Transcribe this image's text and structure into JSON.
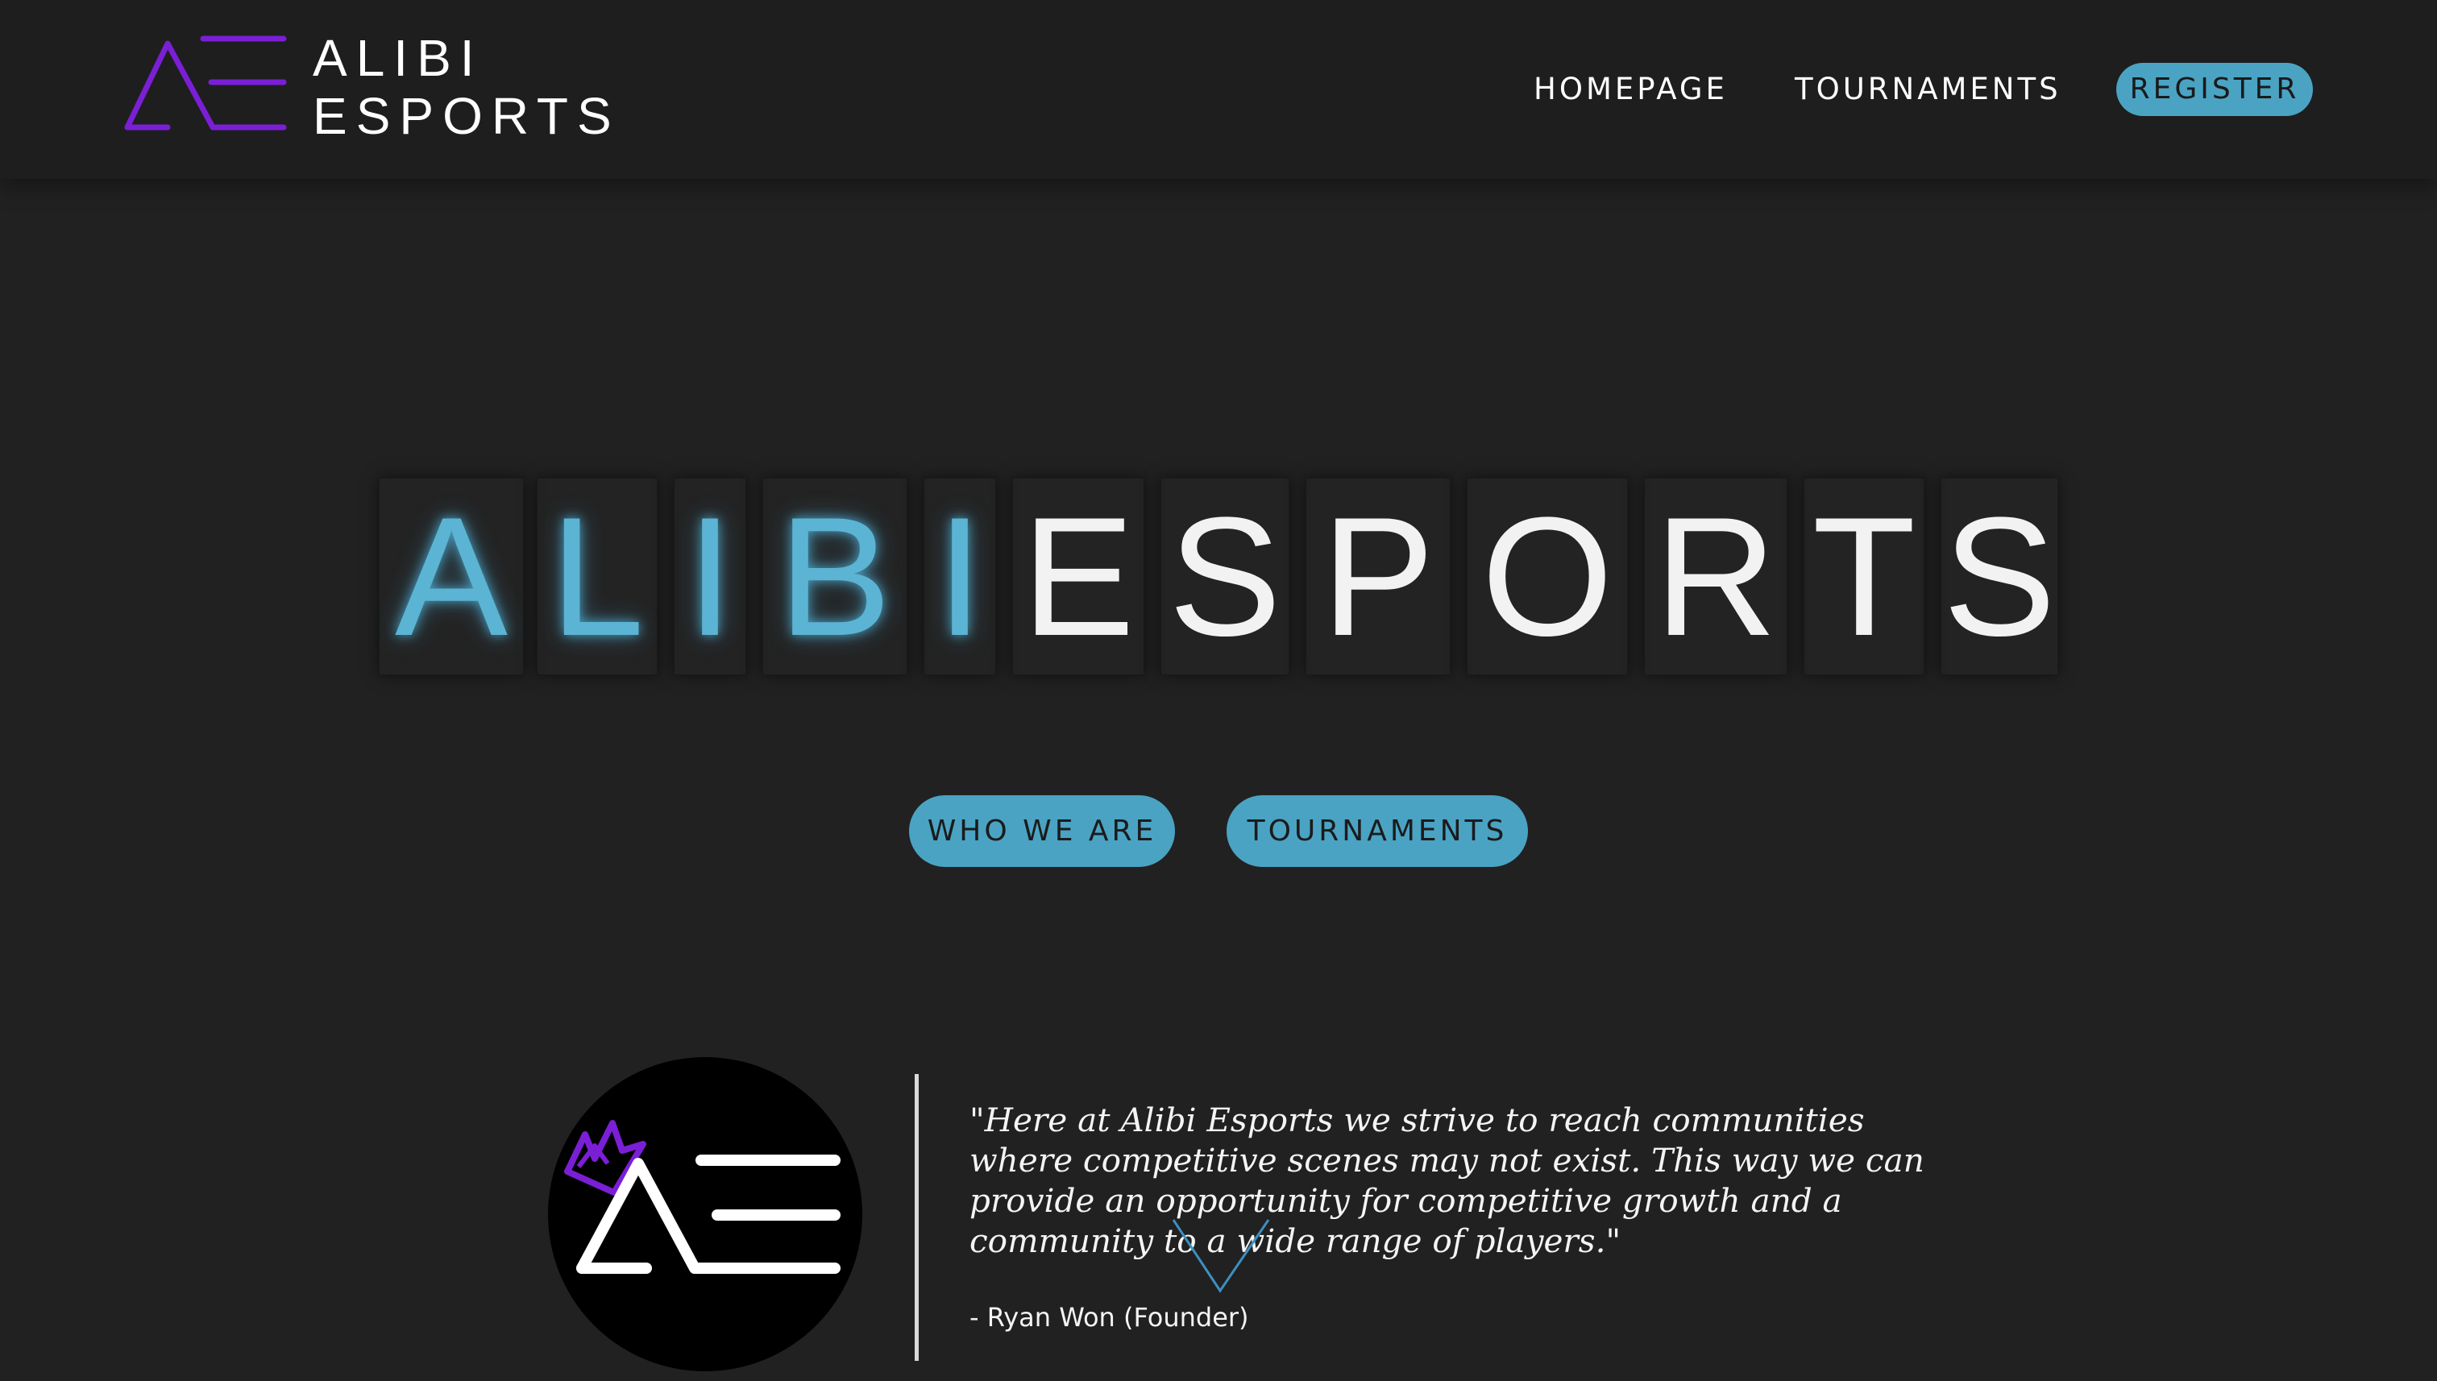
{
  "header": {
    "logo": {
      "line1": "ALIBI",
      "line2": "ESPORTS",
      "icon": "ae-logo-icon",
      "accent": "#7a1fd6"
    },
    "nav": {
      "homepage": "HOMEPAGE",
      "tournaments": "TOURNAMENTS",
      "register": "REGISTER"
    }
  },
  "hero": {
    "title_glow": [
      "A",
      "L",
      "I",
      "B",
      "I"
    ],
    "title_plain": [
      "E",
      "S",
      "P",
      "O",
      "R",
      "T",
      "S"
    ],
    "glow_color": "#5bb4d3"
  },
  "cta": {
    "who_we_are": "WHO WE ARE",
    "tournaments": "TOURNAMENTS"
  },
  "quote": {
    "text": "\"Here at Alibi Esports we strive to reach communities where competitive scenes may not exist. This way we can provide an opportunity for competitive growth and a community to a wide range of players.\"",
    "author": "- Ryan Won (Founder)",
    "badge_icon": "ae-crown-logo-icon"
  },
  "colors": {
    "background": "#212121",
    "header": "#1e1e1e",
    "button": "#4aa3c3",
    "logo_purple": "#7a1fd6"
  }
}
